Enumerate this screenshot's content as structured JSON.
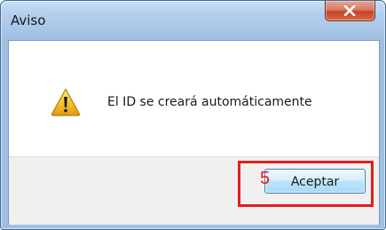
{
  "window": {
    "title": "Aviso"
  },
  "message": {
    "text": "El ID se creará automáticamente",
    "icon": "warning-icon"
  },
  "footer": {
    "accept_label": "Aceptar",
    "annotation_number": "5"
  },
  "colors": {
    "annotation_red": "#e41e1e",
    "close_button_red": "#c2452b",
    "title_bar_blue": "#b5d0ec"
  }
}
